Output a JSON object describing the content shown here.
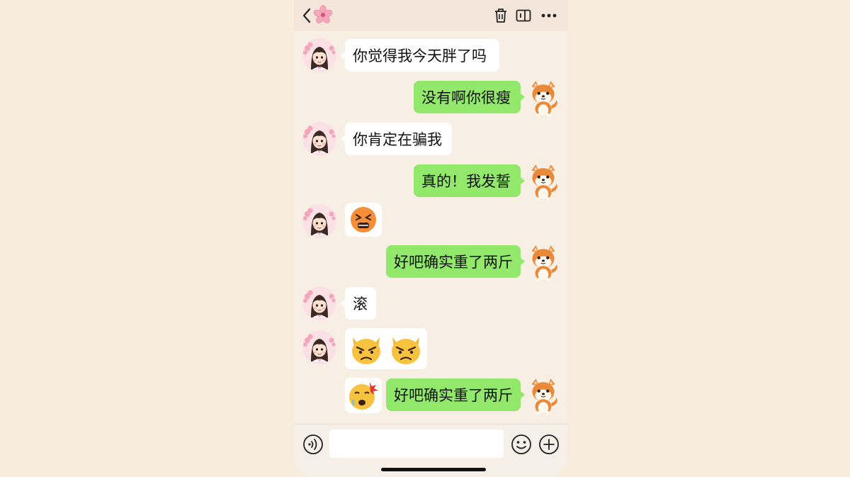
{
  "header": {
    "back_icon": "chevron-left-icon",
    "title_icon": "cherry-blossom-icon",
    "actions": [
      "trash-icon",
      "sidebar-panel-icon",
      "more-dots-icon"
    ]
  },
  "messages": [
    {
      "side": "left",
      "text": "你觉得我今天胖了吗"
    },
    {
      "side": "right",
      "text": "没有啊你很瘦"
    },
    {
      "side": "left",
      "text": "你肯定在骗我"
    },
    {
      "side": "right",
      "text": "真的！我发誓"
    },
    {
      "side": "left",
      "emoji": [
        "persevering-face-emoji"
      ]
    },
    {
      "side": "right",
      "text": "好吧确实重了两斤"
    },
    {
      "side": "left",
      "text": "滚"
    },
    {
      "side": "left",
      "emoji": [
        "pouting-cat-emoji",
        "pouting-cat-emoji"
      ]
    },
    {
      "side": "right",
      "text": "好吧确实重了两斤",
      "sticker": "bumped-head-face-emoji"
    }
  ],
  "avatars": {
    "left": "girl-avatar",
    "right": "shiba-dog-avatar"
  },
  "footer": {
    "voice_icon": "voice-icon",
    "input_value": "",
    "input_placeholder": "",
    "emoji_icon": "smiley-icon",
    "plus_icon": "plus-icon"
  },
  "colors": {
    "background": "#f8eddc",
    "header": "#f5e6dc",
    "bubble_green": "#92e86a",
    "bubble_white": "#ffffff"
  }
}
